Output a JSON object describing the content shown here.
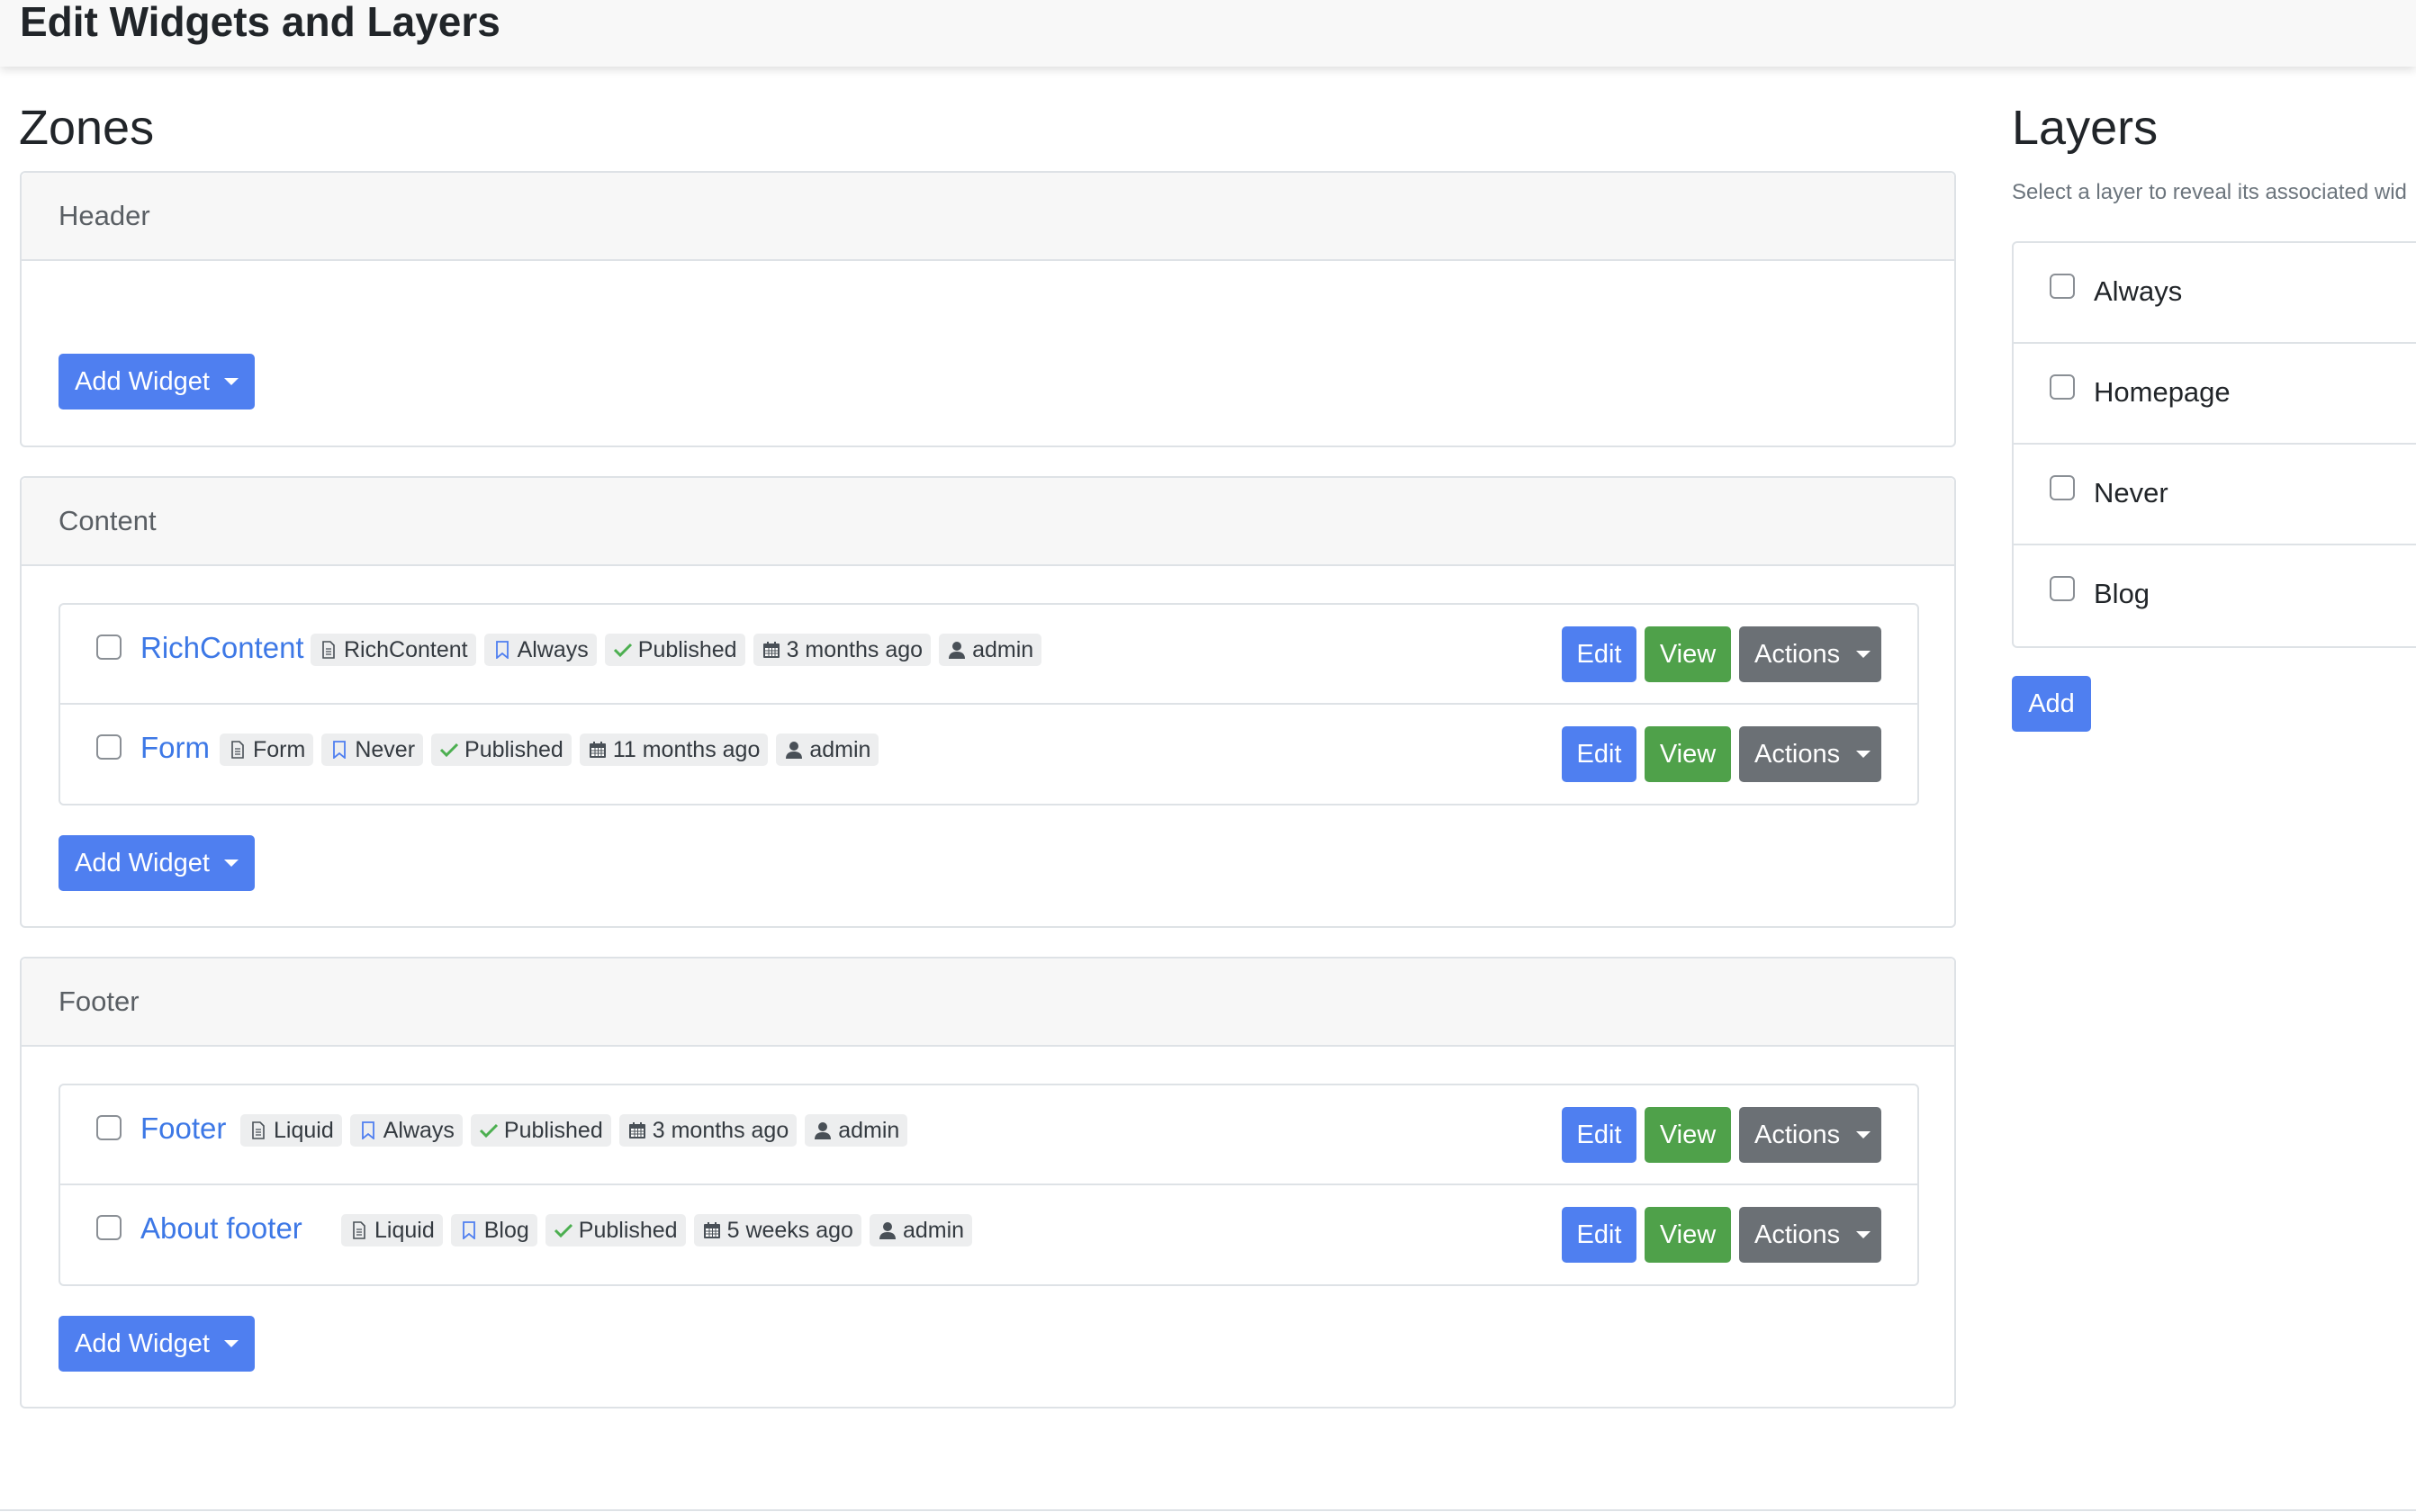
{
  "page": {
    "title": "Edit Widgets and Layers"
  },
  "zones_section": {
    "heading": "Zones",
    "zones": [
      {
        "name": "Header",
        "add_widget_label": "Add Widget",
        "widgets": []
      },
      {
        "name": "Content",
        "add_widget_label": "Add Widget",
        "widgets": [
          {
            "name": "RichContent",
            "type": "RichContent",
            "layer": "Always",
            "status": "Published",
            "modified": "3 months ago",
            "author": "admin"
          },
          {
            "name": "Form",
            "type": "Form",
            "layer": "Never",
            "status": "Published",
            "modified": "11 months ago",
            "author": "admin"
          }
        ]
      },
      {
        "name": "Footer",
        "add_widget_label": "Add Widget",
        "widgets": [
          {
            "name": "Footer",
            "type": "Liquid",
            "layer": "Always",
            "status": "Published",
            "modified": "3 months ago",
            "author": "admin"
          },
          {
            "name": "About footer",
            "type": "Liquid",
            "layer": "Blog",
            "status": "Published",
            "modified": "5 weeks ago",
            "author": "admin"
          }
        ]
      }
    ]
  },
  "widget_buttons": {
    "edit": "Edit",
    "view": "View",
    "actions": "Actions"
  },
  "layers_section": {
    "heading": "Layers",
    "hint": "Select a layer to reveal its associated wid",
    "layers": [
      "Always",
      "Homepage",
      "Never",
      "Blog"
    ],
    "add_label": "Add"
  },
  "icons": {
    "type": "file-icon",
    "layer": "bookmark-icon",
    "status": "check-icon",
    "modified": "calendar-icon",
    "author": "user-icon",
    "dropdown": "caret-down-icon"
  },
  "colors": {
    "primary": "#4f7ff0",
    "success": "#4fa14a",
    "secondary": "#6b7075",
    "link": "#3d78e6",
    "check": "#4caf50",
    "bookmark": "#4f7ff0"
  }
}
